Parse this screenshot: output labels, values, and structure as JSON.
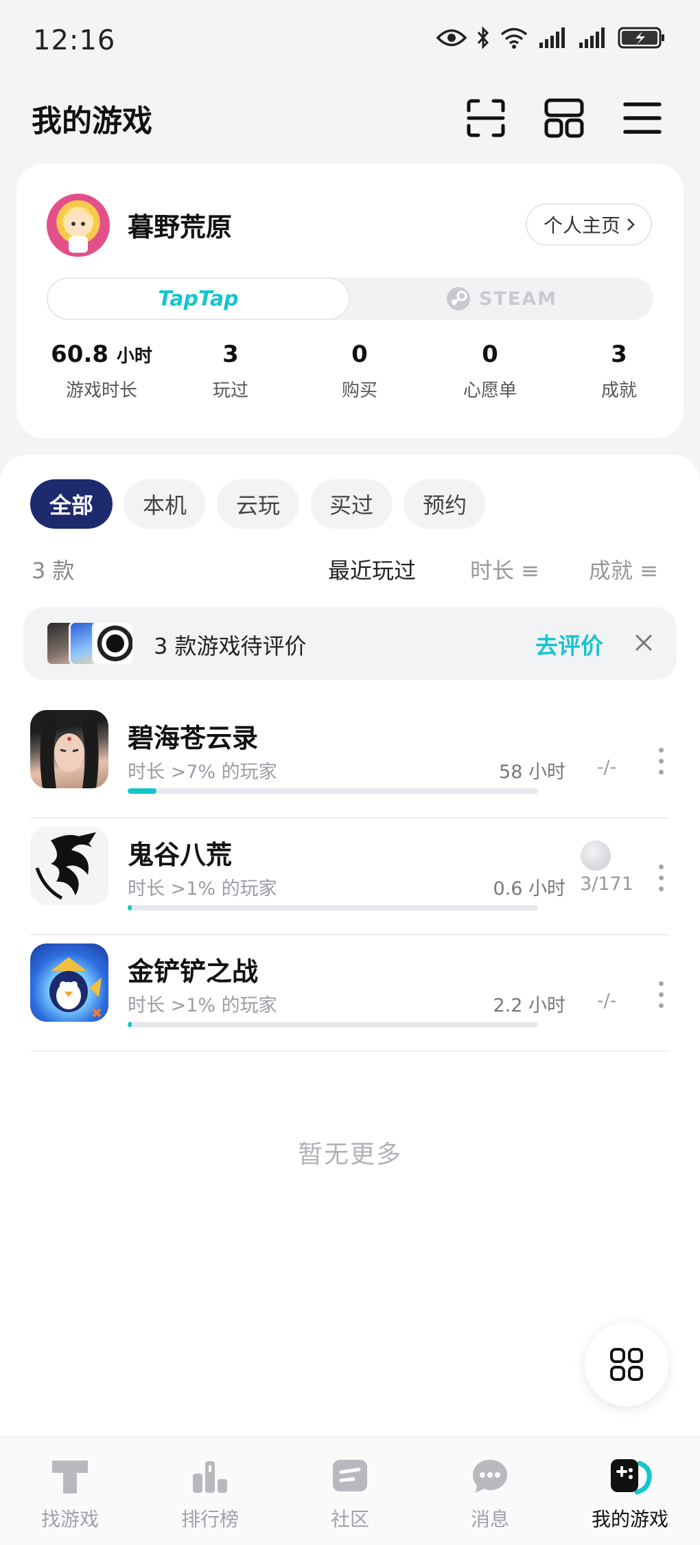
{
  "status_bar": {
    "time": "12:16",
    "battery": "charging"
  },
  "header": {
    "title": "我的游戏",
    "icons": [
      "scan-icon",
      "grid-icon",
      "menu-icon"
    ]
  },
  "profile": {
    "username": "暮野荒原",
    "profile_button": "个人主页",
    "platforms": {
      "taptap": "TapTap",
      "steam": "STEAM"
    },
    "stats": [
      {
        "value": "60.8",
        "unit": "小时",
        "label": "游戏时长"
      },
      {
        "value": "3",
        "unit": "",
        "label": "玩过"
      },
      {
        "value": "0",
        "unit": "",
        "label": "购买"
      },
      {
        "value": "0",
        "unit": "",
        "label": "心愿单"
      },
      {
        "value": "3",
        "unit": "",
        "label": "成就"
      }
    ]
  },
  "filters": [
    "全部",
    "本机",
    "云玩",
    "买过",
    "预约"
  ],
  "active_filter": "全部",
  "sort": {
    "count": "3 款",
    "options": [
      "最近玩过",
      "时长 ≡",
      "成就 ≡"
    ]
  },
  "review_banner": {
    "text": "3 款游戏待评价",
    "action": "去评价"
  },
  "games": [
    {
      "name": "碧海苍云录",
      "sub": "时长 >7% 的玩家",
      "hours": "58 小时",
      "progress": 0.07,
      "achievement": "-/-",
      "has_badge": false
    },
    {
      "name": "鬼谷八荒",
      "sub": "时长 >1% 的玩家",
      "hours": "0.6 小时",
      "progress": 0.01,
      "achievement": "3/171",
      "has_badge": true
    },
    {
      "name": "金铲铲之战",
      "sub": "时长 >1% 的玩家",
      "hours": "2.2 小时",
      "progress": 0.01,
      "achievement": "-/-",
      "has_badge": false
    }
  ],
  "no_more": "暂无更多",
  "bottom_nav": [
    {
      "label": "找游戏",
      "icon": "find-games-icon"
    },
    {
      "label": "排行榜",
      "icon": "leaderboard-icon"
    },
    {
      "label": "社区",
      "icon": "community-icon"
    },
    {
      "label": "消息",
      "icon": "message-icon"
    },
    {
      "label": "我的游戏",
      "icon": "my-games-icon"
    }
  ],
  "colors": {
    "accent": "#15c5ce",
    "active_chip": "#1d2a6e"
  }
}
